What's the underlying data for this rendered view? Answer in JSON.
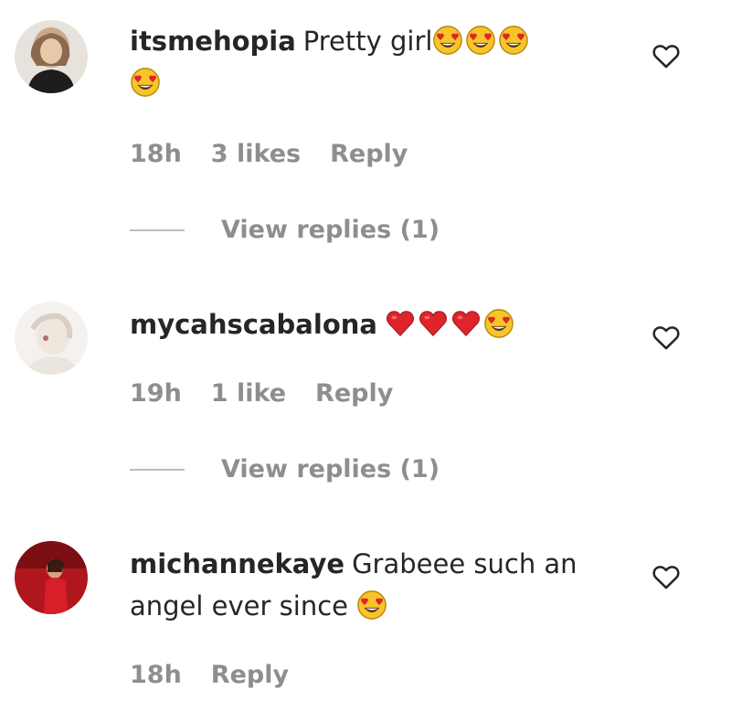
{
  "comments": [
    {
      "username": "itsmehopia",
      "text": "Pretty girl",
      "emojis": [
        "heart-eyes",
        "heart-eyes",
        "heart-eyes",
        "heart-eyes"
      ],
      "time": "18h",
      "likes": "3 likes",
      "reply": "Reply",
      "view_replies": "View replies (1)"
    },
    {
      "username": "mycahscabalona",
      "text": "",
      "emojis": [
        "red-heart",
        "red-heart",
        "red-heart",
        "heart-eyes"
      ],
      "time": "19h",
      "likes": "1 like",
      "reply": "Reply",
      "view_replies": "View replies (1)"
    },
    {
      "username": "michannekaye",
      "text": "Grabeee such an angel ever since",
      "emojis": [
        "heart-eyes"
      ],
      "time": "18h",
      "reply": "Reply"
    }
  ],
  "icons": {
    "like": "heart-outline-icon",
    "heart_eyes": "heart-eyes-emoji",
    "red_heart": "red-heart-emoji"
  },
  "colors": {
    "text": "#262626",
    "secondary": "#8e8e8e",
    "emoji_yellow": "#f7c52a",
    "heart_red": "#e0242b"
  }
}
